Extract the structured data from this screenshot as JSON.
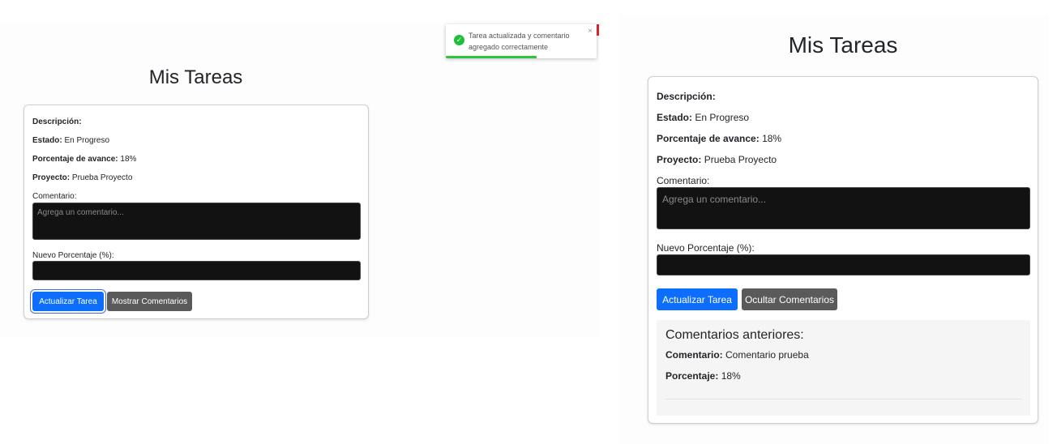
{
  "toast": {
    "message": "Tarea actualizada y comentario agregado correctamente",
    "close_symbol": "×",
    "check_symbol": "✓",
    "progress_fraction": 0.6
  },
  "left": {
    "title": "Mis Tareas",
    "task": {
      "descripcion_label": "Descripción:",
      "estado_label": "Estado:",
      "estado_value": "En Progreso",
      "porcentaje_label": "Porcentaje de avance:",
      "porcentaje_value": "18%",
      "proyecto_label": "Proyecto:",
      "proyecto_value": "Prueba Proyecto"
    },
    "form": {
      "comentario_label": "Comentario:",
      "comentario_placeholder": "Agrega un comentario...",
      "porcentaje_label": "Nuevo Porcentaje (%):"
    },
    "buttons": {
      "update": "Actualizar Tarea",
      "toggle_comments": "Mostrar Comentarios"
    }
  },
  "right": {
    "title": "Mis Tareas",
    "task": {
      "descripcion_label": "Descripción:",
      "estado_label": "Estado:",
      "estado_value": "En Progreso",
      "porcentaje_label": "Porcentaje de avance:",
      "porcentaje_value": "18%",
      "proyecto_label": "Proyecto:",
      "proyecto_value": "Prueba Proyecto"
    },
    "form": {
      "comentario_label": "Comentario:",
      "comentario_placeholder": "Agrega un comentario...",
      "porcentaje_label": "Nuevo Porcentaje (%):"
    },
    "buttons": {
      "update": "Actualizar Tarea",
      "toggle_comments": "Ocultar Comentarios"
    },
    "comments": {
      "heading": "Comentarios anteriores:",
      "items": [
        {
          "comentario_label": "Comentario:",
          "comentario_value": "Comentario prueba",
          "porcentaje_label": "Porcentaje:",
          "porcentaje_value": "18%"
        }
      ]
    }
  },
  "colors": {
    "primary": "#0d6efd",
    "secondary": "#5a5a5a",
    "success": "#1fbf3a",
    "input_bg": "#121212"
  }
}
